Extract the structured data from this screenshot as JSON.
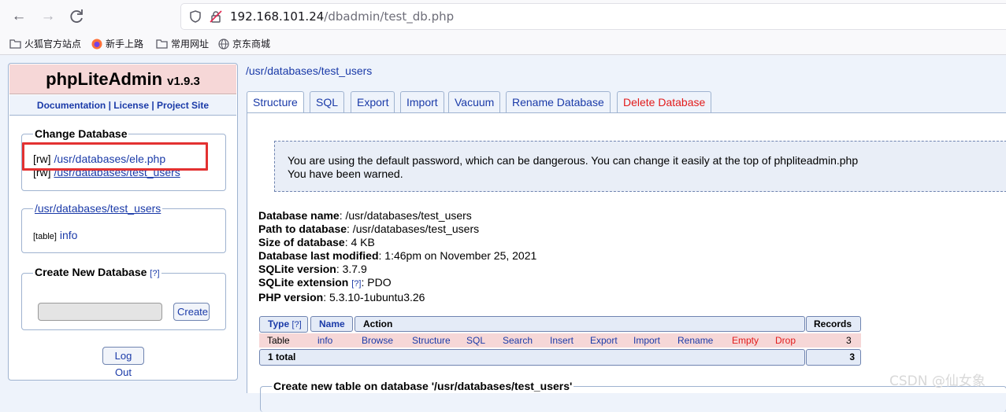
{
  "browser": {
    "url_host": "192.168.101.24",
    "url_path": "/dbadmin/test_db.php",
    "bookmarks": [
      "火狐官方站点",
      "新手上路",
      "常用网址",
      "京东商城"
    ]
  },
  "sidebar": {
    "app_name": "phpLiteAdmin",
    "version": "v1.9.3",
    "links": [
      "Documentation",
      "License",
      "Project Site"
    ],
    "separator": " | ",
    "change_db": {
      "legend": "Change Database",
      "items": [
        {
          "mode": "[rw]",
          "path": "/usr/databases/ele.php"
        },
        {
          "mode": "[rw]",
          "path": "/usr/databases/test_users"
        }
      ]
    },
    "current_db": {
      "legend": "/usr/databases/test_users",
      "table_tag": "[table]",
      "table_name": "info"
    },
    "create_db": {
      "legend": "Create New Database",
      "help": "[?]",
      "button": "Create"
    },
    "logout": "Log Out"
  },
  "main": {
    "breadcrumb": "/usr/databases/test_users",
    "tabs": [
      "Structure",
      "SQL",
      "Export",
      "Import",
      "Vacuum",
      "Rename Database",
      "Delete Database"
    ],
    "warning_line1": "You are using the default password, which can be dangerous. You can change it easily at the top of phpliteadmin.php",
    "warning_line2": "You have been warned.",
    "info": [
      {
        "label": "Database name",
        "value": ": /usr/databases/test_users"
      },
      {
        "label": "Path to database",
        "value": ": /usr/databases/test_users"
      },
      {
        "label": "Size of database",
        "value": ": 4 KB"
      },
      {
        "label": "Database last modified",
        "value": ": 1:46pm on November 25, 2021"
      },
      {
        "label": "SQLite version",
        "value": ": 3.7.9"
      },
      {
        "label": "SQLite extension",
        "help": "[?]",
        "value": ": PDO"
      },
      {
        "label": "PHP version",
        "value": ": 5.3.10-1ubuntu3.26"
      }
    ],
    "table": {
      "headers": {
        "type": "Type",
        "type_help": "[?]",
        "name": "Name",
        "action": "Action",
        "records": "Records"
      },
      "row": {
        "type": "Table",
        "name": "info",
        "actions": [
          "Browse",
          "Structure",
          "SQL",
          "Search",
          "Insert",
          "Export",
          "Import",
          "Rename",
          "Empty",
          "Drop"
        ],
        "records": "3"
      },
      "total_label": "1 total",
      "total_records": "3"
    },
    "create_table_legend": "Create new table on database '/usr/databases/test_users'"
  },
  "watermark": "CSDN @仙女象",
  "colors": {
    "link": "#1a3aa8",
    "danger": "#e21b1b",
    "highlight_box": "#e33131"
  }
}
